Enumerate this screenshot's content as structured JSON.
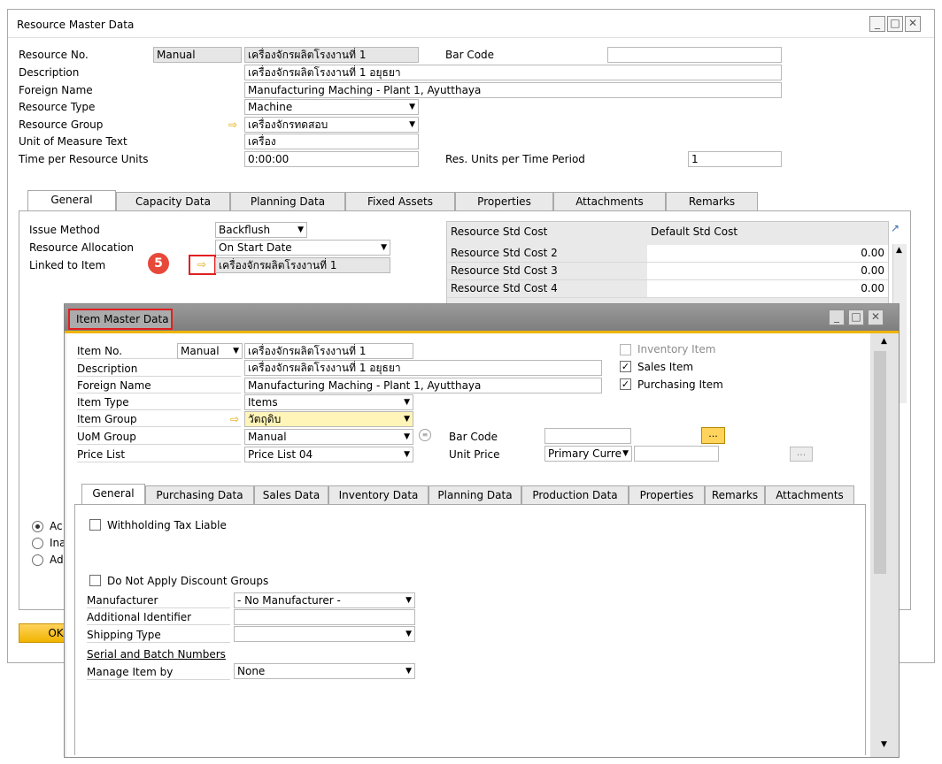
{
  "resource_window": {
    "title": "Resource Master Data",
    "fields": {
      "resource_no_label": "Resource No.",
      "resource_no_series": "Manual",
      "resource_no_value": "เครื่องจักรผลิตโรงงานที่ 1",
      "bar_code_label": "Bar Code",
      "bar_code_value": "",
      "description_label": "Description",
      "description_value": "เครื่องจักรผลิตโรงงานที่ 1 อยุธยา",
      "foreign_name_label": "Foreign Name",
      "foreign_name_value": "Manufacturing Maching - Plant 1, Ayutthaya",
      "resource_type_label": "Resource Type",
      "resource_type_value": "Machine",
      "resource_group_label": "Resource Group",
      "resource_group_value": "เครื่องจักรทดสอบ",
      "uom_text_label": "Unit of Measure Text",
      "uom_text_value": "เครื่อง",
      "time_per_unit_label": "Time per Resource Units",
      "time_per_unit_value": "0:00:00",
      "res_units_label": "Res. Units per Time Period",
      "res_units_value": "1"
    },
    "tabs": [
      "General",
      "Capacity Data",
      "Planning Data",
      "Fixed Assets",
      "Properties",
      "Attachments",
      "Remarks"
    ],
    "general": {
      "issue_method_label": "Issue Method",
      "issue_method_value": "Backflush",
      "resource_allocation_label": "Resource Allocation",
      "resource_allocation_value": "On Start Date",
      "linked_item_label": "Linked to Item",
      "linked_item_value": "เครื่องจักรผลิตโรงงานที่ 1",
      "step_badge": "5"
    },
    "cost_grid": {
      "col1": "Resource Std Cost",
      "col2": "Default Std Cost",
      "rows": [
        {
          "label": "Resource Std Cost 2",
          "value": "0.00"
        },
        {
          "label": "Resource Std Cost 3",
          "value": "0.00"
        },
        {
          "label": "Resource Std Cost 4",
          "value": "0.00"
        }
      ]
    },
    "status_radios": [
      "Ac",
      "Ina",
      "Ad"
    ],
    "ok_label": "OK"
  },
  "item_window": {
    "title": "Item Master Data",
    "fields": {
      "item_no_label": "Item No.",
      "item_no_series": "Manual",
      "item_no_value": "เครื่องจักรผลิตโรงงานที่ 1",
      "description_label": "Description",
      "description_value": "เครื่องจักรผลิตโรงงานที่ 1 อยุธยา",
      "foreign_name_label": "Foreign Name",
      "foreign_name_value": "Manufacturing Maching - Plant 1, Ayutthaya",
      "item_type_label": "Item Type",
      "item_type_value": "Items",
      "item_group_label": "Item Group",
      "item_group_value": "วัตถุดิบ",
      "uom_group_label": "UoM Group",
      "uom_group_value": "Manual",
      "price_list_label": "Price List",
      "price_list_value": "Price List 04",
      "bar_code_label": "Bar Code",
      "bar_code_value": "",
      "unit_price_label": "Unit Price",
      "unit_price_currency": "Primary Currer",
      "unit_price_value": "",
      "ellipsis": "..."
    },
    "checks": {
      "inventory_item": "Inventory Item",
      "sales_item": "Sales Item",
      "purchasing_item": "Purchasing Item"
    },
    "tabs": [
      "General",
      "Purchasing Data",
      "Sales Data",
      "Inventory Data",
      "Planning Data",
      "Production Data",
      "Properties",
      "Remarks",
      "Attachments"
    ],
    "general": {
      "withholding_tax": "Withholding Tax Liable",
      "no_discount": "Do Not Apply Discount Groups",
      "manufacturer_label": "Manufacturer",
      "manufacturer_value": "- No Manufacturer -",
      "additional_id_label": "Additional Identifier",
      "additional_id_value": "",
      "shipping_type_label": "Shipping Type",
      "shipping_type_value": "",
      "serial_batch_label": "Serial and Batch Numbers",
      "manage_item_label": "Manage Item by",
      "manage_item_value": "None"
    }
  },
  "colors": {
    "highlight_red": "#e02020",
    "badge_red": "#e8483a",
    "arrow_yellow": "#e0a800",
    "title_gray": "#8a8a8a",
    "accent_orange": "#f0b400"
  }
}
